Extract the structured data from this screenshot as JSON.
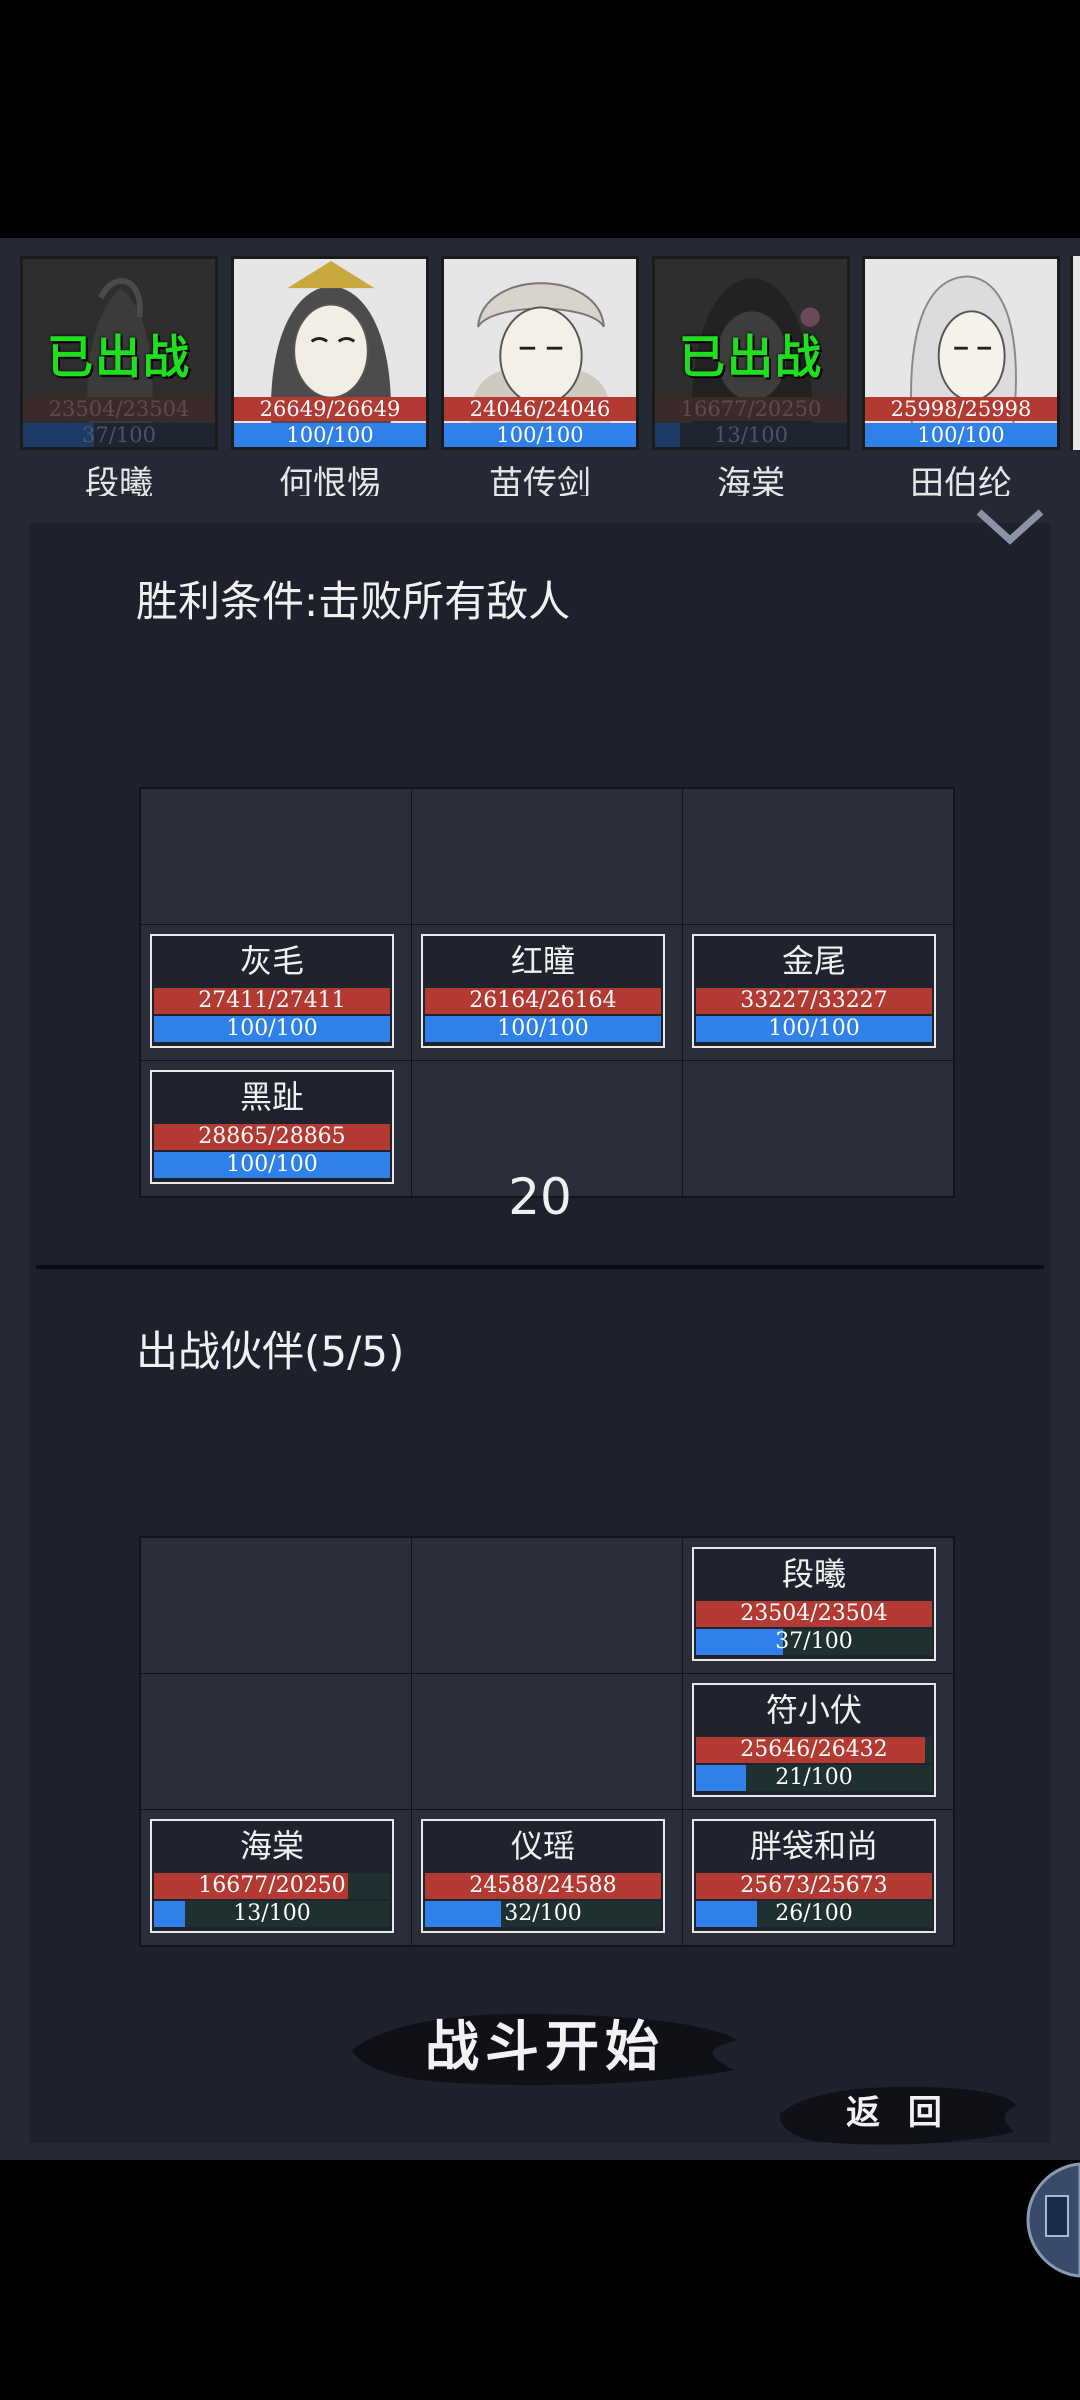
{
  "roster": [
    {
      "name": "段曦",
      "hp": "23504/23504",
      "mp": "37/100",
      "mp_fraction": 0.37,
      "deployed": true
    },
    {
      "name": "何恨惕",
      "hp": "26649/26649",
      "mp": "100/100",
      "mp_fraction": 1.0,
      "deployed": false
    },
    {
      "name": "苗传剑",
      "hp": "24046/24046",
      "mp": "100/100",
      "mp_fraction": 1.0,
      "deployed": false
    },
    {
      "name": "海棠",
      "hp": "16677/20250",
      "mp": "13/100",
      "mp_fraction": 0.13,
      "deployed": true
    },
    {
      "name": "田伯纶",
      "hp": "25998/25998",
      "mp": "100/100",
      "mp_fraction": 1.0,
      "deployed": false
    }
  ],
  "deployed_label": "已出战",
  "victory_condition": "胜利条件:击败所有敌人",
  "enemies": [
    {
      "name": "灰毛",
      "hp": "27411/27411",
      "mp": "100/100",
      "hp_fraction": 1.0,
      "mp_fraction": 1.0
    },
    {
      "name": "红瞳",
      "hp": "26164/26164",
      "mp": "100/100",
      "hp_fraction": 1.0,
      "mp_fraction": 1.0
    },
    {
      "name": "金尾",
      "hp": "33227/33227",
      "mp": "100/100",
      "hp_fraction": 1.0,
      "mp_fraction": 1.0
    },
    {
      "name": "黑趾",
      "hp": "28865/28865",
      "mp": "100/100",
      "hp_fraction": 1.0,
      "mp_fraction": 1.0
    }
  ],
  "turn_count": "20",
  "party_title": "出战伙伴(5/5)",
  "party": [
    {
      "name": "段曦",
      "hp": "23504/23504",
      "mp": "37/100",
      "hp_fraction": 1.0,
      "mp_fraction": 0.37
    },
    {
      "name": "符小伏",
      "hp": "25646/26432",
      "mp": "21/100",
      "hp_fraction": 0.97,
      "mp_fraction": 0.21
    },
    {
      "name": "海棠",
      "hp": "16677/20250",
      "mp": "13/100",
      "hp_fraction": 0.82,
      "mp_fraction": 0.13
    },
    {
      "name": "仪瑶",
      "hp": "24588/24588",
      "mp": "32/100",
      "hp_fraction": 1.0,
      "mp_fraction": 0.32
    },
    {
      "name": "胖袋和尚",
      "hp": "25673/25673",
      "mp": "26/100",
      "hp_fraction": 1.0,
      "mp_fraction": 0.26
    }
  ],
  "buttons": {
    "start": "战斗开始",
    "back": "返 回"
  },
  "colors": {
    "hp": "#b33a32",
    "mp": "#2f80e8",
    "deployed_tag": "#1fe01f",
    "background": "#252936"
  },
  "icons": {
    "collapse": "chevron-down-icon"
  }
}
